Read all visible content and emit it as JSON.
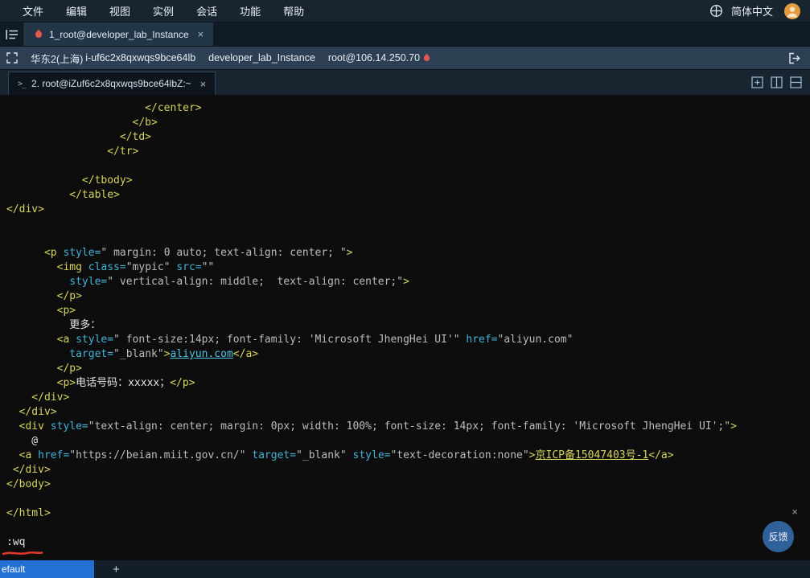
{
  "menu_bar": {
    "items": [
      "文件",
      "编辑",
      "视图",
      "实例",
      "会话",
      "功能",
      "帮助"
    ],
    "language": "简体中文"
  },
  "session_tabs": {
    "active_tab": {
      "label": "1_root@developer_lab_Instance",
      "close": "×"
    }
  },
  "instance_bar": {
    "region": "华东2(上海)",
    "instance_id": "i-uf6c2x8qxwqs9bce64lb",
    "instance_name": "developer_lab_Instance",
    "user_host": "root@106.14.250.70"
  },
  "terminal_tabs": {
    "active_tab": {
      "prompt_icon": ">_",
      "label": "2. root@iZuf6c2x8qxwqs9bce64lbZ:~",
      "close": "×"
    }
  },
  "terminal": {
    "lines": [
      [
        [
          "tag",
          "                      </center>"
        ]
      ],
      [
        [
          "tag",
          "                    </b>"
        ]
      ],
      [
        [
          "tag",
          "                  </td>"
        ]
      ],
      [
        [
          "tag",
          "                </tr>"
        ]
      ],
      [],
      [
        [
          "tag",
          "            </tbody>"
        ]
      ],
      [
        [
          "tag",
          "          </table>"
        ]
      ],
      [
        [
          "tag",
          "</div>"
        ]
      ],
      [],
      [],
      [
        [
          "tag",
          "      <p"
        ],
        [
          "attr",
          " style="
        ],
        [
          "str",
          "\" margin: 0 auto; text-align: center; \""
        ],
        [
          "tag",
          ">"
        ]
      ],
      [
        [
          "tag",
          "        <img"
        ],
        [
          "attr",
          " class="
        ],
        [
          "str",
          "\"mypic\""
        ],
        [
          "attr",
          " src="
        ],
        [
          "str",
          "\"\""
        ]
      ],
      [
        [
          "attr",
          "          style="
        ],
        [
          "str",
          "\" vertical-align: middle;  text-align: center;\""
        ],
        [
          "tag",
          ">"
        ]
      ],
      [
        [
          "tag",
          "        </p>"
        ]
      ],
      [
        [
          "tag",
          "        <p>"
        ]
      ],
      [
        [
          "txt",
          "          更多："
        ]
      ],
      [
        [
          "tag",
          "        <a"
        ],
        [
          "attr",
          " style="
        ],
        [
          "str",
          "\" font-size:14px; font-family: 'Microsoft JhengHei UI'\""
        ],
        [
          "attr",
          " href="
        ],
        [
          "str",
          "\"aliyun.com\""
        ]
      ],
      [
        [
          "attr",
          "          target="
        ],
        [
          "str",
          "\"_blank\""
        ],
        [
          "tag",
          ">"
        ],
        [
          "lnkc",
          "aliyun.com"
        ],
        [
          "tag",
          "</a>"
        ]
      ],
      [
        [
          "tag",
          "        </p>"
        ]
      ],
      [
        [
          "tag",
          "        <p>"
        ],
        [
          "txt",
          "电话号码：xxxxx；"
        ],
        [
          "tag",
          "</p>"
        ]
      ],
      [
        [
          "tag",
          "    </div>"
        ]
      ],
      [
        [
          "tag",
          "  </div>"
        ]
      ],
      [
        [
          "tag",
          "  <div"
        ],
        [
          "attr",
          " style="
        ],
        [
          "str",
          "\"text-align: center; margin: 0px; width: 100%; font-size: 14px; font-family: 'Microsoft JhengHei UI';\""
        ],
        [
          "tag",
          ">"
        ]
      ],
      [
        [
          "txt",
          "    @"
        ]
      ],
      [
        [
          "tag",
          "  <a"
        ],
        [
          "attr",
          " href="
        ],
        [
          "str",
          "\"https://beian.miit.gov.cn/\""
        ],
        [
          "attr",
          " target="
        ],
        [
          "str",
          "\"_blank\""
        ],
        [
          "attr",
          " style="
        ],
        [
          "str",
          "\"text-decoration:none\""
        ],
        [
          "tag",
          ">"
        ],
        [
          "lnky",
          "京ICP备15047403号-1"
        ],
        [
          "tag",
          "</a>"
        ]
      ],
      [
        [
          "tag",
          " </div>"
        ]
      ],
      [
        [
          "tag",
          "</body>"
        ]
      ],
      [],
      [
        [
          "tag",
          "</html>"
        ]
      ],
      [],
      [
        [
          "cmd",
          ":wq"
        ]
      ]
    ]
  },
  "feedback": {
    "label": "反馈",
    "close": "×"
  },
  "status_bar": {
    "profile": "efault",
    "add": "+"
  },
  "colors": {
    "accent_blue": "#2270d3",
    "tab_bg": "#223648",
    "instance_bar_bg": "#2c3f53",
    "syntax_tag": "#d6d35e",
    "syntax_attr": "#43b2d5",
    "session_icon_red": "#e2574c",
    "annotation_red": "#de372b"
  }
}
